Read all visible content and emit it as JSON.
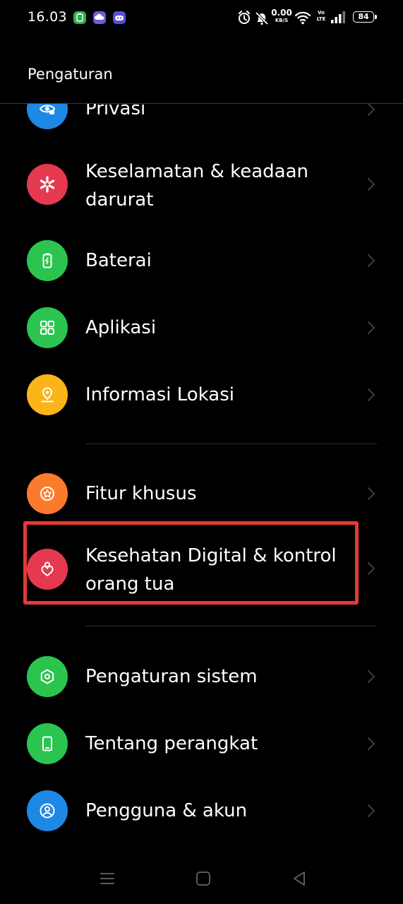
{
  "status_bar": {
    "time": "16.03",
    "net_speed_value": "0.00",
    "net_speed_unit": "KB/S",
    "volte_top": "Vo",
    "volte_bottom": "LTE",
    "battery": "84"
  },
  "header": {
    "title": "Pengaturan"
  },
  "settings": {
    "items": [
      {
        "label": "Privasi",
        "icon": "privacy-icon",
        "color": "#1e88e5"
      },
      {
        "label": "Keselamatan & keadaan darurat",
        "icon": "emergency-icon",
        "color": "#e53950"
      },
      {
        "label": "Baterai",
        "icon": "battery-icon",
        "color": "#2bc44f"
      },
      {
        "label": "Aplikasi",
        "icon": "apps-icon",
        "color": "#2bc44f"
      },
      {
        "label": "Informasi Lokasi",
        "icon": "location-icon",
        "color": "#fbb41a"
      },
      {
        "label": "Fitur khusus",
        "icon": "special-features-icon",
        "color": "#fb7b2d"
      },
      {
        "label": "Kesehatan Digital & kontrol orang tua",
        "icon": "digital-wellbeing-icon",
        "color": "#e53950"
      },
      {
        "label": "Pengaturan sistem",
        "icon": "system-settings-icon",
        "color": "#2bc44f"
      },
      {
        "label": "Tentang perangkat",
        "icon": "device-icon",
        "color": "#2bc44f"
      },
      {
        "label": "Pengguna & akun",
        "icon": "user-account-icon",
        "color": "#1e88e5"
      }
    ]
  },
  "colors": {
    "highlight": "#e53935",
    "background": "#000000"
  }
}
